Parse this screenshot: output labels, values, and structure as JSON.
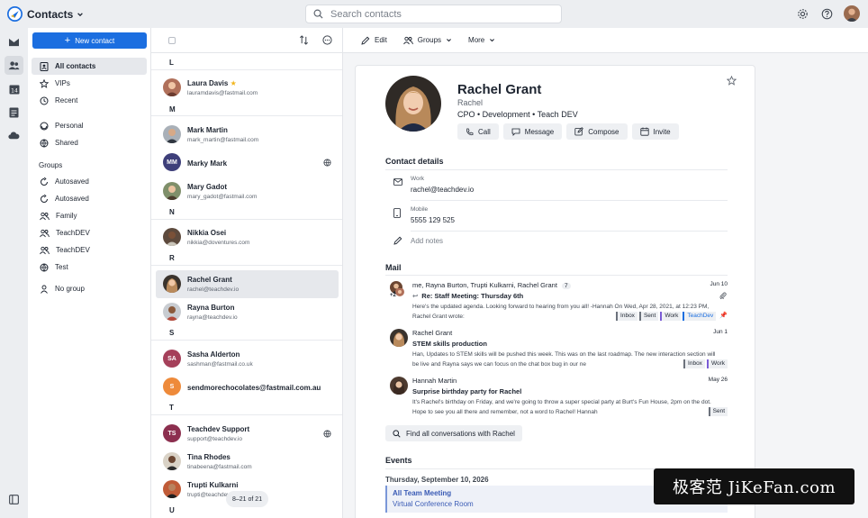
{
  "app": {
    "title": "Contacts"
  },
  "search": {
    "placeholder": "Search contacts"
  },
  "sidebar": {
    "new_contact": "New contact",
    "nav": [
      {
        "label": "All contacts",
        "icon": "contact-book-icon",
        "active": true
      },
      {
        "label": "VIPs",
        "icon": "star-icon"
      },
      {
        "label": "Recent",
        "icon": "history-icon"
      },
      {
        "label": "Personal",
        "icon": "circle-icon"
      },
      {
        "label": "Shared",
        "icon": "globe-icon"
      }
    ],
    "groups_heading": "Groups",
    "groups": [
      {
        "label": "Autosaved",
        "icon": "autosave-icon"
      },
      {
        "label": "Autosaved",
        "icon": "autosave-icon"
      },
      {
        "label": "Family",
        "icon": "group-icon"
      },
      {
        "label": "TeachDEV",
        "icon": "group-icon"
      },
      {
        "label": "TeachDEV",
        "icon": "group-icon"
      },
      {
        "label": "Test",
        "icon": "globe-icon"
      },
      {
        "label": "No group",
        "icon": "person-icon"
      }
    ]
  },
  "list": {
    "letters": {
      "l": "L",
      "m": "M",
      "n": "N",
      "r": "R",
      "s": "S",
      "t": "T",
      "u": "U"
    },
    "contacts": [
      {
        "name": "Laura Davis",
        "email": "lauramdavis@fastmail.com",
        "vip": true
      },
      {
        "name": "Mark Martin",
        "email": "mark_martin@fastmail.com"
      },
      {
        "name": "Marky Mark",
        "initials": "MM",
        "shared": true
      },
      {
        "name": "Mary Gadot",
        "email": "mary_gadot@fastmail.com"
      },
      {
        "name": "Nikkia Osei",
        "email": "nikkia@doventures.com"
      },
      {
        "name": "Rachel Grant",
        "email": "rachel@teachdev.io",
        "selected": true
      },
      {
        "name": "Rayna Burton",
        "email": "rayna@teachdev.io"
      },
      {
        "name": "Sasha Alderton",
        "email": "sashman@fastmail.co.uk",
        "initials": "SA"
      },
      {
        "name": "sendmorechocolates@fastmail.com.au",
        "initials": "S"
      },
      {
        "name": "Teachdev Support",
        "email": "support@teachdev.io",
        "initials": "TS",
        "shared": true
      },
      {
        "name": "Tina Rhodes",
        "email": "tinabeena@fastmail.com"
      },
      {
        "name": "Trupti Kulkarni",
        "email": "trupti@teachdev.io"
      }
    ],
    "pager": "8–21 of 21"
  },
  "toolbar": {
    "edit": "Edit",
    "groups": "Groups",
    "more": "More"
  },
  "person": {
    "name": "Rachel Grant",
    "nickname": "Rachel",
    "role": "CPO • Development • Teach DEV",
    "actions": [
      "Call",
      "Message",
      "Compose",
      "Invite"
    ]
  },
  "contact_details": {
    "title": "Contact details",
    "work_label": "Work",
    "work_value": "rachel@teachdev.io",
    "mobile_label": "Mobile",
    "mobile_value": "5555 129 525",
    "notes_placeholder": "Add notes"
  },
  "mail": {
    "title": "Mail",
    "items": [
      {
        "from": "me, Rayna Burton, Trupti Kulkarni, Rachel Grant",
        "count": "7",
        "date": "Jun 10",
        "subject": "Re: Staff Meeting: Thursday 6th",
        "snippet": "Here's the updated agenda. Looking forward to hearing from you all! -Hannah On Wed, Apr 28, 2021, at 12:23 PM, Rachel Grant wrote:",
        "tags": [
          "Inbox",
          "Sent",
          "Work",
          "TeachDev"
        ],
        "extra_avatars": "+2"
      },
      {
        "from": "Rachel Grant",
        "date": "Jun 1",
        "subject": "STEM skills production",
        "snippet": "Han, Updates to STEM skills will be pushed this week. This was on the last roadmap. The new interaction section will be live and Rayna says we can focus on the chat box bug in our ne",
        "tags": [
          "Inbox",
          "Work"
        ]
      },
      {
        "from": "Hannah Martin",
        "date": "May 26",
        "subject": "Surprise birthday party for Rachel",
        "snippet": "It's Rachel's birthday on Friday, and we're going to throw a super special party at Burt's Fun House, 2pm on the dot. Hope to see you all there and remember, not a word to Rachel! Hannah",
        "tags": [
          "Sent"
        ]
      }
    ],
    "find_all": "Find all conversations with Rachel"
  },
  "events": {
    "title": "Events",
    "date": "Thursday, September 10, 2026",
    "event_title": "All Team Meeting",
    "event_location": "Virtual Conference Room"
  },
  "watermark": "极客范 JiKeFan.com",
  "colors": {
    "accent": "#1b6ee0",
    "vip_star": "#f2b51c",
    "event": "#3a5bb5"
  }
}
